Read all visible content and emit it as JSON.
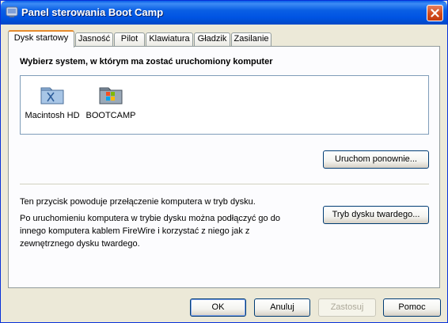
{
  "window": {
    "title": "Panel sterowania Boot Camp"
  },
  "tabs": [
    {
      "label": "Dysk startowy",
      "active": true
    },
    {
      "label": "Jasność"
    },
    {
      "label": "Pilot"
    },
    {
      "label": "Klawiatura"
    },
    {
      "label": "Gładzik"
    },
    {
      "label": "Zasilanie"
    }
  ],
  "startup": {
    "heading": "Wybierz system, w którym ma zostać uruchomiony komputer",
    "disks": [
      {
        "label": "Macintosh  HD",
        "icon": "mac-disk-icon"
      },
      {
        "label": "BOOTCAMP",
        "icon": "windows-disk-icon"
      }
    ],
    "restart_label": "Uruchom ponownie...",
    "target_mode_line1": "Ten przycisk powoduje przełączenie komputera w tryb dysku.",
    "target_mode_line2": "Po uruchomieniu komputera w trybie dysku można podłączyć go do innego komputera kablem FireWire i korzystać z niego jak z zewnętrznego dysku twardego.",
    "target_mode_button": "Tryb dysku twardego..."
  },
  "footer": {
    "ok": "OK",
    "cancel": "Anuluj",
    "apply": "Zastosuj",
    "help": "Pomoc"
  },
  "colors": {
    "titlebar": "#0054e3",
    "tab_accent": "#e68b2c",
    "close": "#d24a1c"
  }
}
